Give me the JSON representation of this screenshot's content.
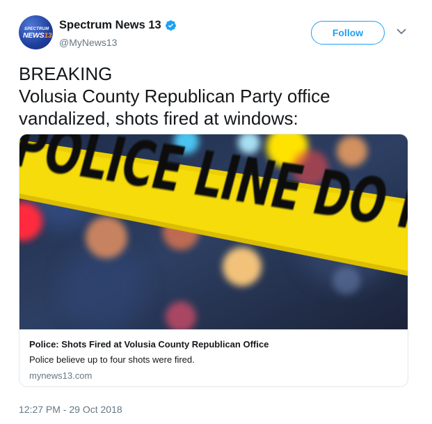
{
  "author": {
    "avatar_top_text": "SPECTRUM",
    "avatar_main_text": "NEWS",
    "avatar_num_text": "13",
    "display_name": "Spectrum News 13",
    "handle": "@MyNews13",
    "verified": true
  },
  "follow_label": "Follow",
  "tweet_text": "BREAKING\nVolusia County Republican Party office\nvandalized, shots fired at windows:",
  "card": {
    "image_text": "POLICE LINE DO NOT CRO",
    "title": "Police: Shots Fired at Volusia County Republican Office",
    "description": "Police believe up to four shots were fired.",
    "domain": "mynews13.com"
  },
  "timestamp": "12:27 PM - 29 Oct 2018",
  "colors": {
    "accent": "#1da1f2",
    "muted": "#657786",
    "tape": "#f5dc0a",
    "text": "#14171a"
  }
}
